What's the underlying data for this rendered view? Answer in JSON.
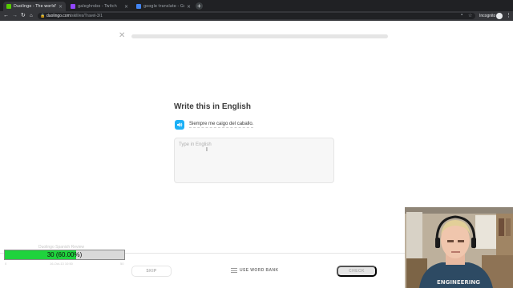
{
  "browser": {
    "tabs": [
      {
        "label": "Duolingo - The world's best",
        "active": true,
        "favicon_color": "#58cc02"
      },
      {
        "label": "galeghrobo - Twitch",
        "active": false,
        "favicon_color": "#9146ff"
      },
      {
        "label": "google translate - Google Search",
        "active": false,
        "favicon_color": "#4285f4"
      }
    ],
    "new_tab": "+",
    "url_host": "duolingo.com",
    "url_path": "/skill/es/Travel-3/1",
    "incognito_label": "Incognito"
  },
  "lesson": {
    "quit_glyph": "✕",
    "progress": 0.0
  },
  "challenge": {
    "title": "Write this in English",
    "prompt": "Siempre me caigo del caballo.",
    "answer_value": "",
    "answer_placeholder": "Type in English"
  },
  "footer": {
    "skip": "SKIP",
    "word_bank": "USE WORD BANK",
    "check": "CHECK"
  },
  "overlay": {
    "title": "Duolingo Spanish Review",
    "bar_text": "30 (60.00%)",
    "bar_value": 0.6,
    "min": "0",
    "date": "16-Oct-13 10:50",
    "max": "50"
  },
  "colors": {
    "accent_green": "#58cc02",
    "speaker_blue": "#1cb0f6",
    "overlay_green": "#1fd33d"
  }
}
